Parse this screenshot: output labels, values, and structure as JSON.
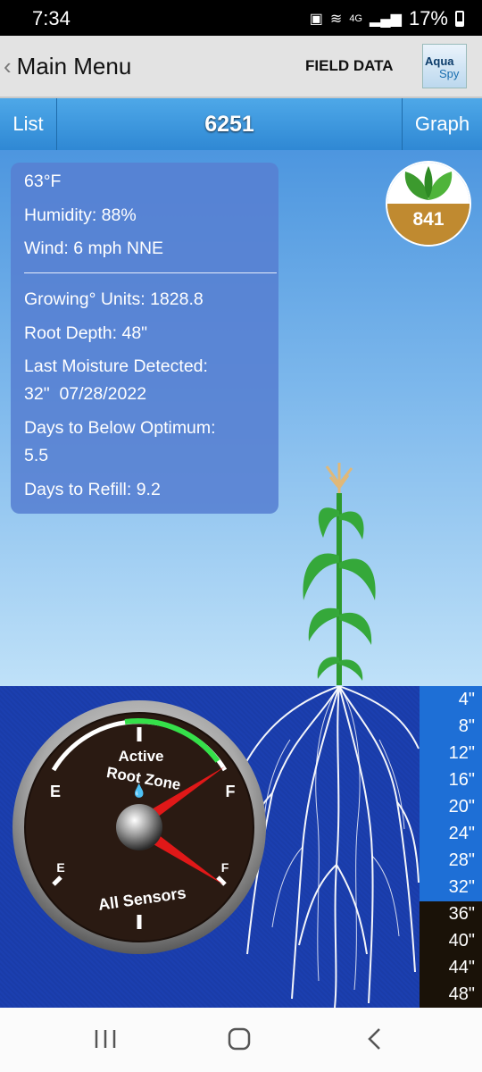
{
  "status_bar": {
    "time": "7:34",
    "network": "4G",
    "battery_pct": "17%"
  },
  "header": {
    "back_label": "Main Menu",
    "title": "FIELD DATA",
    "logo_line1": "Aqua",
    "logo_line2": "Spy"
  },
  "tabs": {
    "left": "List",
    "title": "6251",
    "right": "Graph"
  },
  "weather": {
    "temperature": "63°F",
    "humidity": "Humidity: 88%",
    "wind": "Wind: 6 mph NNE"
  },
  "stats": {
    "growing_units": "Growing° Units: 1828.8",
    "root_depth": "Root Depth: 48\"",
    "last_moisture_label": "Last Moisture Detected:",
    "last_moisture_value": "32\"  07/28/2022",
    "days_below_label": "Days to Below Optimum:",
    "days_below_value": "5.5",
    "days_refill": "Days to Refill: 9.2"
  },
  "badge": {
    "value": "841",
    "icon": "leaves-icon"
  },
  "gauge": {
    "top_label_1": "Active",
    "top_label_2": "Root Zone",
    "bottom_label": "All Sensors",
    "empty_label": "E",
    "full_label": "F",
    "active_root_zone_level": 0.92,
    "all_sensors_level": 0.95
  },
  "depths": [
    "4\"",
    "8\"",
    "12\"",
    "16\"",
    "20\"",
    "24\"",
    "28\"",
    "32\"",
    "36\"",
    "40\"",
    "44\"",
    "48\""
  ],
  "colors": {
    "tab_bar": "#3f9ae0",
    "panel": "#5680d2",
    "soil": "#1a3ca8",
    "badge_soil": "#c08a30",
    "gauge_green": "#35e04a",
    "needle_red": "#e01818"
  },
  "nav": {
    "recent_icon": "recent-apps-icon",
    "home_icon": "home-icon",
    "back_icon": "back-icon"
  }
}
